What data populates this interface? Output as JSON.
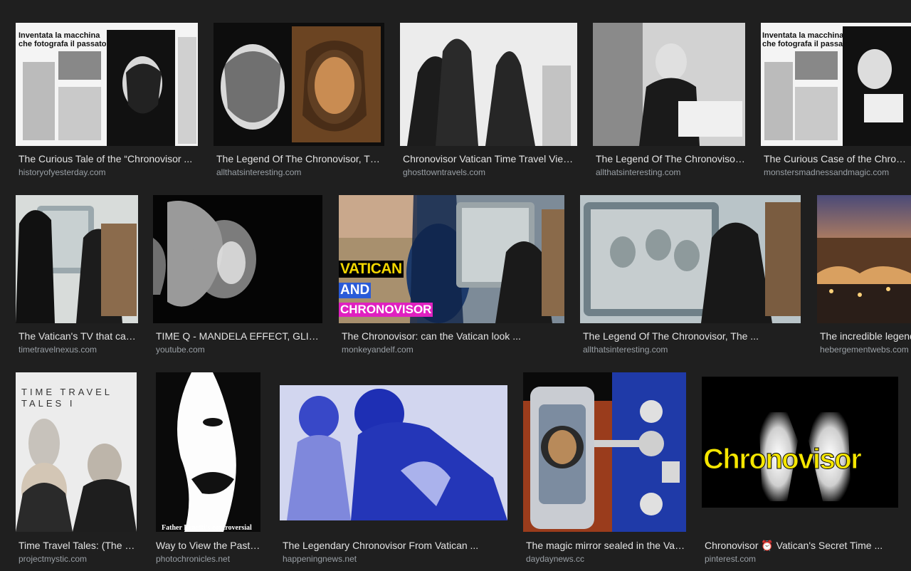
{
  "results": [
    {
      "title": "The Curious Tale of the “Chronovisor ...",
      "source": "historyofyesterday.com",
      "thumb_text": [
        "Inventata la macchina",
        "che fotografa il passato"
      ]
    },
    {
      "title": "The Legend Of The Chronovisor, The ...",
      "source": "allthatsinteresting.com"
    },
    {
      "title": "Chronovisor Vatican Time Travel View...",
      "source": "ghosttowntravels.com"
    },
    {
      "title": "The Legend Of The Chronovisor, ...",
      "source": "allthatsinteresting.com"
    },
    {
      "title": "The Curious Case of the Chronov...",
      "source": "monstersmadnessandmagic.com",
      "thumb_text": [
        "Inventata la macchina",
        "che fotografa il passato"
      ]
    },
    {
      "title": "The Vatican's TV that can...",
      "source": "timetravelnexus.com"
    },
    {
      "title": "TIME Q - MANDELA EFFECT, GLITCH...",
      "source": "youtube.com"
    },
    {
      "title": "The Chronovisor: can the Vatican look ...",
      "source": "monkeyandelf.com",
      "thumb_text": [
        "VATICAN",
        "AND",
        "CHRONOVISOR"
      ]
    },
    {
      "title": "The Legend Of The Chronovisor, The ...",
      "source": "allthatsinteresting.com"
    },
    {
      "title": "The incredible legend",
      "source": "hebergementwebs.com"
    },
    {
      "title": "Time Travel Tales: (The C...",
      "source": "projectmystic.com",
      "thumb_text": [
        "TIME TRAVEL",
        "TALES I"
      ]
    },
    {
      "title": "Way to View the Past? ...",
      "source": "photochronicles.net",
      "thumb_text": [
        "Father Ernetti's controversial"
      ]
    },
    {
      "title": "The Legendary Chronovisor From Vatican ...",
      "source": "happeningnews.net"
    },
    {
      "title": "The magic mirror sealed in the Vati...",
      "source": "daydaynews.cc"
    },
    {
      "title": "Chronovisor ⏰ Vatican's Secret Time ...",
      "source": "pinterest.com",
      "thumb_text": [
        "Chronovisor"
      ]
    }
  ],
  "colors": {
    "background": "#1f1f1f",
    "title": "#e3e3e3",
    "source": "#9aa0a6",
    "chronovisor_yellow": "#f5e600",
    "vatican_yellow": "#f2d600",
    "and_blue": "#2a5bd8",
    "chronovisor_magenta": "#e020c0"
  }
}
